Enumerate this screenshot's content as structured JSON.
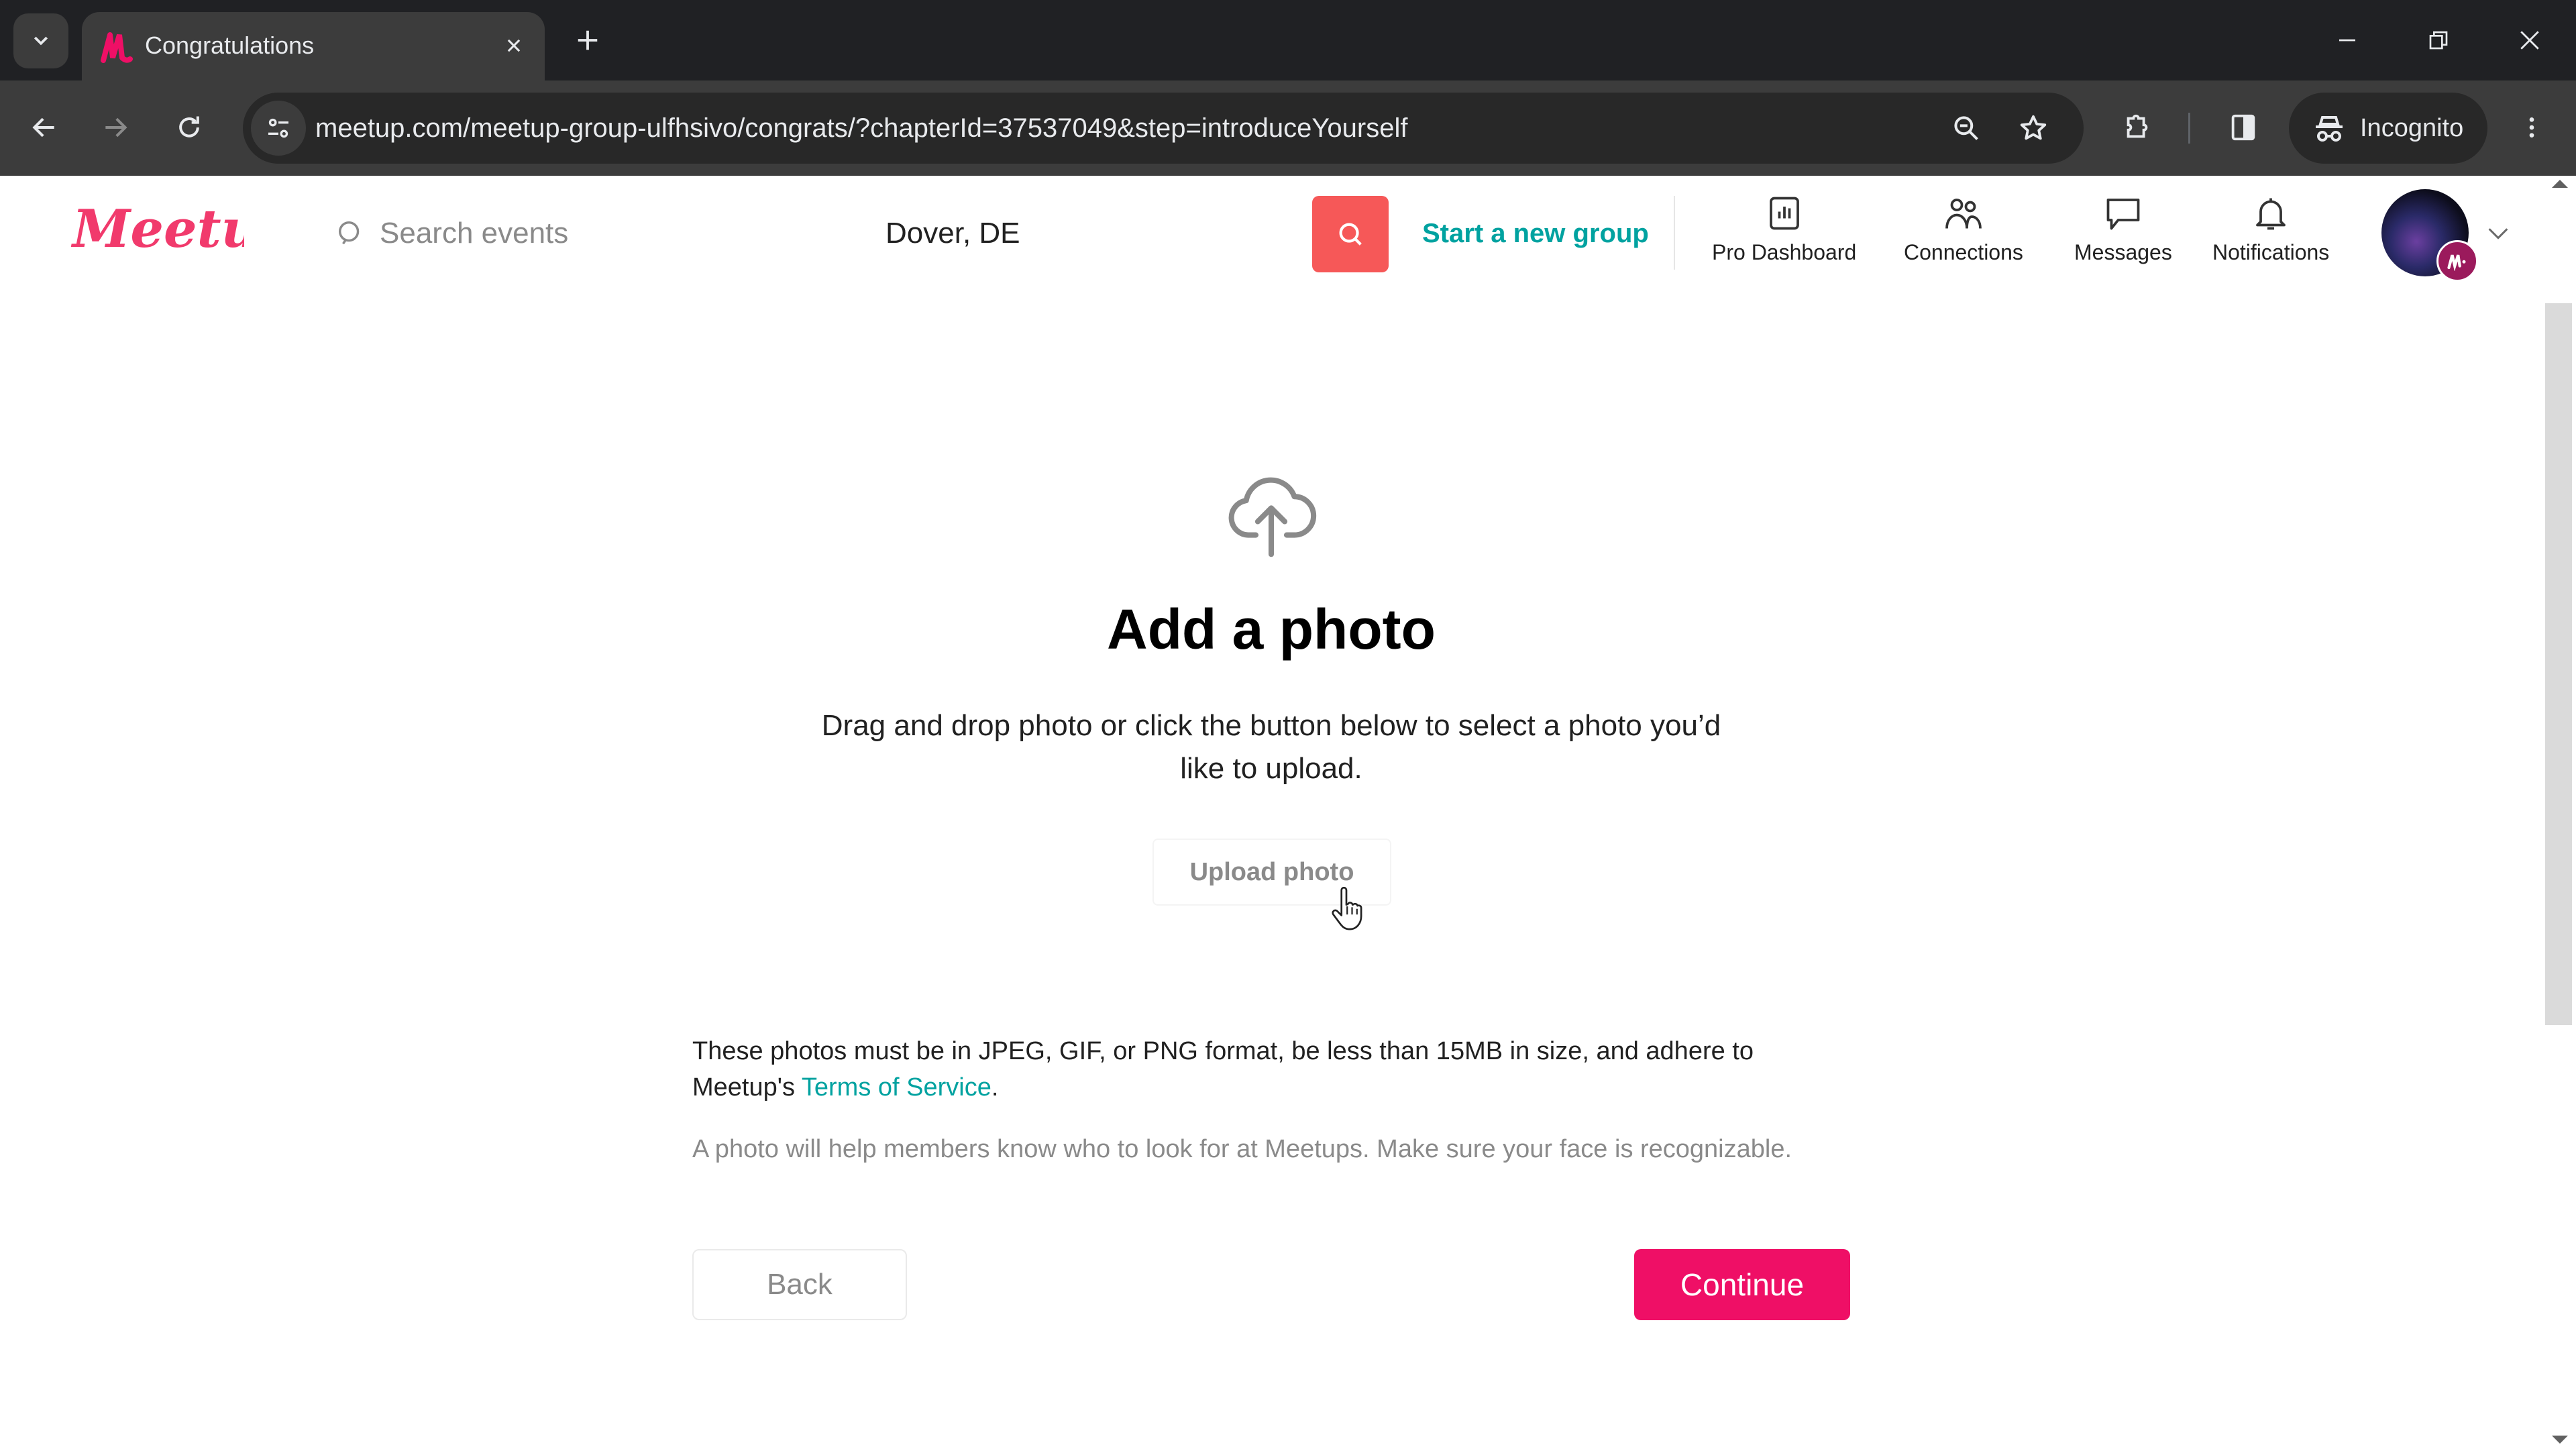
{
  "browser": {
    "tab_title": "Congratulations",
    "url": "meetup.com/meetup-group-ulfhsivo/congrats/?chapterId=37537049&step=introduceYourself",
    "profile_label": "Incognito"
  },
  "header": {
    "logo_text": "Meetup",
    "search_placeholder": "Search events",
    "location": "Dover, DE",
    "start_group_label": "Start a new group",
    "nav": [
      {
        "label": "Pro Dashboard",
        "icon": "bar-chart-icon"
      },
      {
        "label": "Connections",
        "icon": "people-icon"
      },
      {
        "label": "Messages",
        "icon": "chat-bubble-icon"
      },
      {
        "label": "Notifications",
        "icon": "bell-icon"
      }
    ]
  },
  "main": {
    "title": "Add a photo",
    "instructions": "Drag and drop photo or click the button below to select a photo you’d like to upload.",
    "upload_label": "Upload photo",
    "rules_text": "These photos must be in JPEG, GIF, or PNG format, be less than 15MB in size, and adhere to Meetup's ",
    "tos_link": "Terms of Service",
    "rules_end": ".",
    "hint": "A photo will help members know who to look for at Meetups. Make sure your face is recognizable.",
    "back_label": "Back",
    "continue_label": "Continue"
  },
  "colors": {
    "brand_pink": "#ef0f66",
    "search_red": "#f65858",
    "link_teal": "#00a2a0"
  }
}
